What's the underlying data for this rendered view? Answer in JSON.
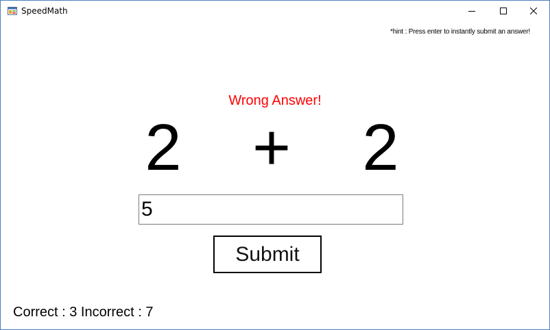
{
  "window": {
    "title": "SpeedMath",
    "icons": {
      "app": "app-icon",
      "minimize": "minimize-icon",
      "maximize": "maximize-icon",
      "close": "close-icon"
    }
  },
  "hint": "*hint : Press enter to instantly submit an answer!",
  "feedback": {
    "text": "Wrong Answer!",
    "color": "#ff0000"
  },
  "problem": {
    "left_operand": "2",
    "operator": "+",
    "right_operand": "2"
  },
  "answer": {
    "value": "5"
  },
  "submit_label": "Submit",
  "score": {
    "text": "Correct : 3 Incorrect : 7",
    "correct": 3,
    "incorrect": 7
  }
}
